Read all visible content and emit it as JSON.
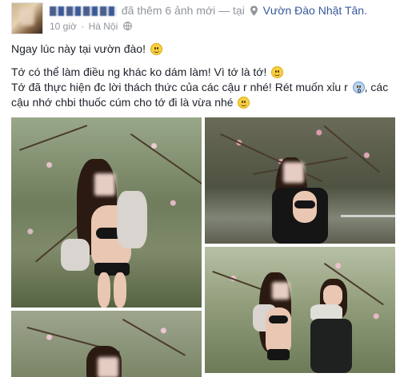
{
  "post": {
    "author_added_text": "đã thêm 6 ảnh mới — tại",
    "location": "Vườn Đào Nhật Tân.",
    "time": "10 giờ",
    "place": "Hà Nội",
    "meta_separator": "·",
    "line1": "Ngay lúc này tại vườn đào!",
    "line2": "Tớ có thể làm điều ng khác ko dám làm! Vì tớ là tớ!",
    "line3a": "Tớ đã thực hiện đc lời thách thức của các cậu r nhé! Rét muốn xỉu r",
    "line3b": ", các cậu nhớ chbi thuốc cúm cho tớ đi là vừa nhé",
    "icons": {
      "pin": "location-pin-icon",
      "globe": "globe-icon",
      "emoji1": "grin-emoji",
      "emoji2": "wink-emoji",
      "emoji3": "scream-emoji",
      "emoji4": "laugh-emoji"
    },
    "colors": {
      "link": "#365899",
      "meta": "#90949c",
      "text": "#1d2129"
    },
    "photo_count": 6
  }
}
